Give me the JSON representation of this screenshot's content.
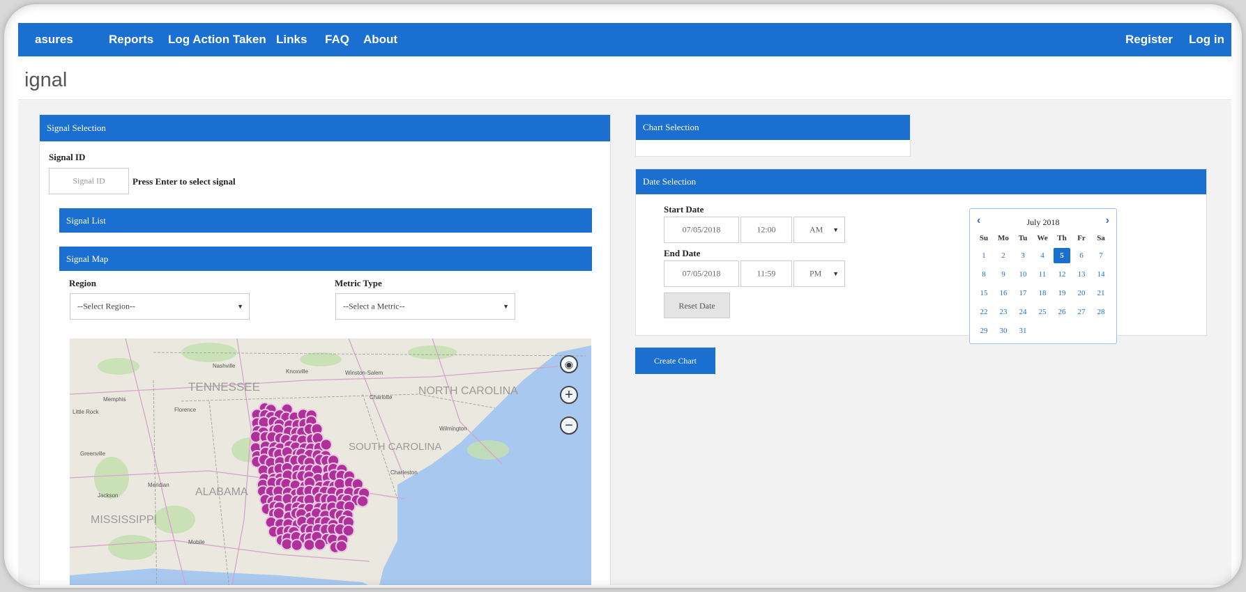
{
  "navbar": {
    "items": [
      "asures",
      "Reports",
      "Log Action Taken",
      "Links",
      "FAQ",
      "About"
    ],
    "register": "Register",
    "login": "Log in"
  },
  "page": {
    "title": "ignal"
  },
  "signal_selection": {
    "header": "Signal Selection",
    "signal_id_label": "Signal ID",
    "signal_id_placeholder": "Signal ID",
    "hint": "Press Enter to select signal",
    "signal_list_header": "Signal List",
    "signal_map_header": "Signal Map",
    "region_label": "Region",
    "region_value": "--Select Region--",
    "metric_label": "Metric Type",
    "metric_value": "--Select a Metric--"
  },
  "map": {
    "labels": [
      "TENNESSEE",
      "NORTH CAROLINA",
      "SOUTH CAROLINA",
      "ALABAMA",
      "MISSISSIPPI",
      "Little Rock",
      "Memphis",
      "Charlotte",
      "Winston-Salem",
      "Wilmington",
      "Charleston",
      "Greenville",
      "Jackson",
      "Meridian",
      "Mobile",
      "Nashville",
      "Knoxville",
      "Florence"
    ],
    "marker_color": "#b0309a"
  },
  "chart_selection": {
    "header": "Chart Selection"
  },
  "date_selection": {
    "header": "Date Selection",
    "start_label": "Start Date",
    "start_date": "07/05/2018",
    "start_time": "12:00",
    "start_ampm": "AM",
    "end_label": "End Date",
    "end_date": "07/05/2018",
    "end_time": "11:59",
    "end_ampm": "PM",
    "reset_label": "Reset Date"
  },
  "calendar": {
    "title": "July 2018",
    "dow": [
      "Su",
      "Mo",
      "Tu",
      "We",
      "Th",
      "Fr",
      "Sa"
    ],
    "days": [
      "1",
      "2",
      "3",
      "4",
      "5",
      "6",
      "7",
      "8",
      "9",
      "10",
      "11",
      "12",
      "13",
      "14",
      "15",
      "16",
      "17",
      "18",
      "19",
      "20",
      "21",
      "22",
      "23",
      "24",
      "25",
      "26",
      "27",
      "28",
      "29",
      "30",
      "31"
    ],
    "selected": "5"
  },
  "create_chart_label": "Create Chart",
  "colors": {
    "primary": "#1a6fd0",
    "marker": "#b0309a"
  }
}
